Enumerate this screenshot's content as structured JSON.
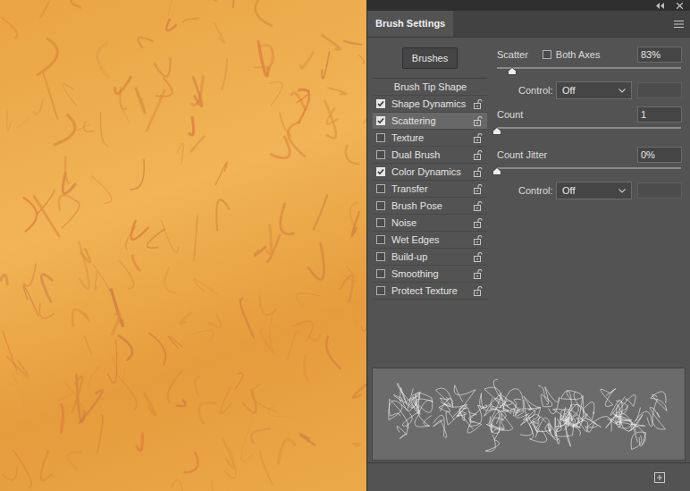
{
  "panel": {
    "title": "Brush Settings"
  },
  "brushes_button": {
    "label": "Brushes"
  },
  "options": [
    {
      "label": "Brush Tip Shape",
      "kind": "heading",
      "selected": false
    },
    {
      "label": "Shape Dynamics",
      "kind": "checkbox",
      "checked": true,
      "selected": false
    },
    {
      "label": "Scattering",
      "kind": "checkbox",
      "checked": true,
      "selected": true
    },
    {
      "label": "Texture",
      "kind": "checkbox",
      "checked": false,
      "selected": false
    },
    {
      "label": "Dual Brush",
      "kind": "checkbox",
      "checked": false,
      "selected": false
    },
    {
      "label": "Color Dynamics",
      "kind": "checkbox",
      "checked": true,
      "selected": false
    },
    {
      "label": "Transfer",
      "kind": "checkbox",
      "checked": false,
      "selected": false
    },
    {
      "label": "Brush Pose",
      "kind": "checkbox",
      "checked": false,
      "selected": false
    },
    {
      "label": "Noise",
      "kind": "checkbox",
      "checked": false,
      "selected": false
    },
    {
      "label": "Wet Edges",
      "kind": "checkbox",
      "checked": false,
      "selected": false
    },
    {
      "label": "Build-up",
      "kind": "checkbox",
      "checked": false,
      "selected": false
    },
    {
      "label": "Smoothing",
      "kind": "checkbox",
      "checked": false,
      "selected": false
    },
    {
      "label": "Protect Texture",
      "kind": "checkbox",
      "checked": false,
      "selected": false
    }
  ],
  "scatter": {
    "label": "Scatter",
    "value": "83%",
    "level": 0.083,
    "both_axes": {
      "label": "Both Axes",
      "checked": false
    },
    "control": {
      "label": "Control:",
      "value": "Off"
    }
  },
  "count": {
    "label": "Count",
    "value": "1",
    "level": 0
  },
  "count_jitter": {
    "label": "Count Jitter",
    "value": "0%",
    "level": 0,
    "control": {
      "label": "Control:",
      "value": "Off"
    }
  }
}
